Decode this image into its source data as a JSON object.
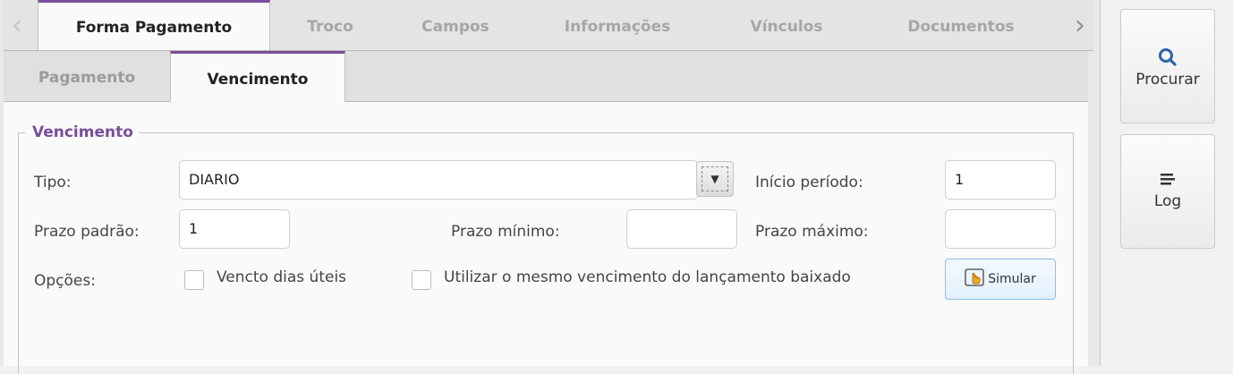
{
  "tabs": {
    "items": [
      {
        "label": "Forma Pagamento"
      },
      {
        "label": "Troco"
      },
      {
        "label": "Campos"
      },
      {
        "label": "Informações"
      },
      {
        "label": "Vínculos"
      },
      {
        "label": "Documentos"
      }
    ]
  },
  "subtabs": {
    "items": [
      {
        "label": "Pagamento"
      },
      {
        "label": "Vencimento"
      }
    ]
  },
  "group": {
    "title": "Vencimento"
  },
  "form": {
    "tipo_label": "Tipo:",
    "tipo_value": "DIARIO",
    "inicio_label": "Início período:",
    "inicio_value": "1",
    "prazo_padrao_label": "Prazo padrão:",
    "prazo_padrao_value": "1",
    "prazo_minimo_label": "Prazo mínimo:",
    "prazo_minimo_value": "",
    "prazo_maximo_label": "Prazo máximo:",
    "prazo_maximo_value": "",
    "opcoes_label": "Opções:",
    "check_dias_uteis_label": "Vencto dias úteis",
    "check_mesmo_venc_label": "Utilizar o mesmo vencimento do lançamento baixado",
    "simular_label": "Simular"
  },
  "side": {
    "procurar_label": "Procurar",
    "log_label": "Log"
  },
  "colors": {
    "accent": "#7a4d9a",
    "sim_border": "#8fbde4"
  }
}
